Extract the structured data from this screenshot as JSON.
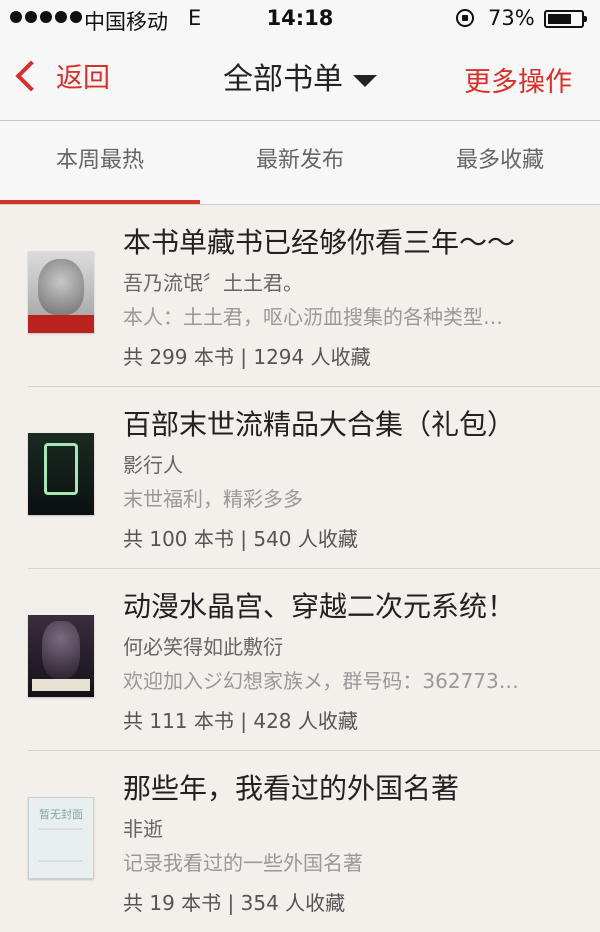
{
  "status_bar": {
    "carrier": "中国移动",
    "network": "E",
    "time": "14:18",
    "battery": "73%",
    "battery_level": 0.73
  },
  "nav": {
    "back_label": "返回",
    "title": "全部书单",
    "more_label": "更多操作"
  },
  "tabs": [
    {
      "label": "本周最热",
      "active": true
    },
    {
      "label": "最新发布",
      "active": false
    },
    {
      "label": "最多收藏",
      "active": false
    }
  ],
  "booklists": [
    {
      "title": "本书单藏书已经够你看三年～～",
      "author": "吾乃流氓〞土土君。",
      "description": "本人：土土君，呕心沥血搜集的各种类型…",
      "stats": "共 299 本书 | 1294 人收藏"
    },
    {
      "title": "百部末世流精品大合集（礼包）",
      "author": "影行人",
      "description": "末世福利，精彩多多",
      "stats": "共 100 本书 | 540 人收藏"
    },
    {
      "title": "动漫水晶宫、穿越二次元系统！",
      "author": "何必笑得如此敷衍",
      "description": "欢迎加入ジ幻想家族メ，群号码：362773…",
      "stats": "共 111 本书 | 428 人收藏"
    },
    {
      "title": "那些年，我看过的外国名著",
      "author": "非逝",
      "description": "记录我看过的一些外国名著",
      "stats": "共 19 本书 | 354 人收藏",
      "cover_caption": "暂无封面"
    }
  ],
  "colors": {
    "accent": "#d8312b",
    "background": "#f3efeb",
    "bar": "#f7f7f7"
  }
}
